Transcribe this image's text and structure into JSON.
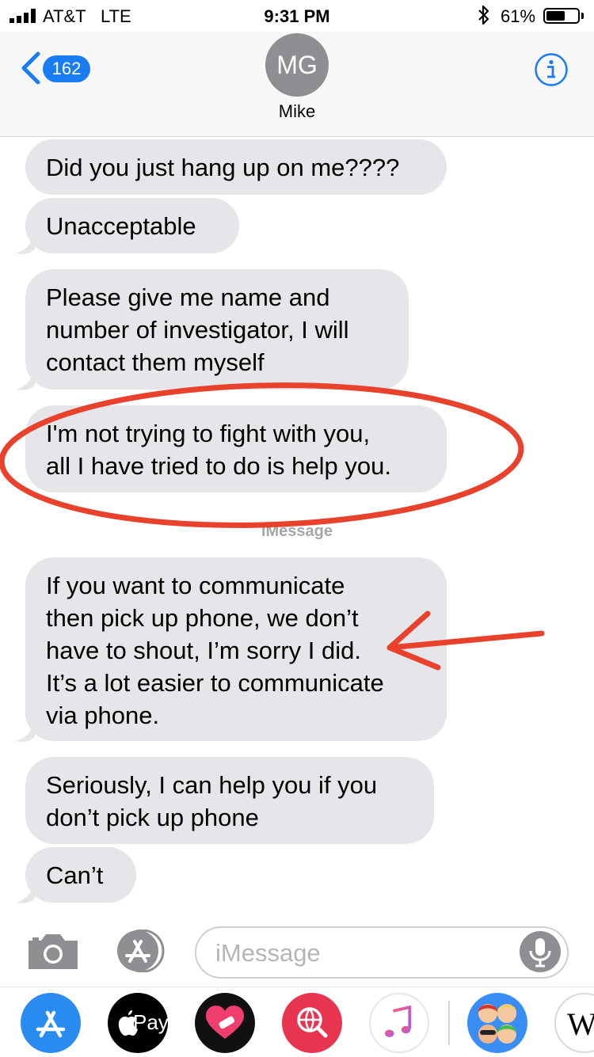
{
  "status_bar": {
    "carrier": "AT&T",
    "network": "LTE",
    "time": "9:31 PM",
    "battery_percent": "61%",
    "battery_level": 0.61
  },
  "header": {
    "back_count": "162",
    "avatar_initials": "MG",
    "contact_name": "Mike"
  },
  "messages": [
    "Did you just hang up on me????",
    "Unacceptable",
    "Please give me name and\nnumber of investigator, I will\ncontact them myself",
    "I'm not trying to fight with you,\nall I have tried to do is help you.",
    "If you want to communicate\nthen pick up phone, we don’t\nhave to shout, I’m sorry I did.\nIt’s a lot easier to communicate\nvia phone.",
    "Seriously, I can help you if you\ndon’t pick up phone",
    "Can’t"
  ],
  "separator_label": "iMessage",
  "input": {
    "placeholder": "iMessage"
  },
  "app_drawer": {
    "apple_pay_label": "Pay",
    "wikipedia_label": "W"
  },
  "colors": {
    "ios_blue": "#1a7cf3",
    "bubble_gray": "#e5e5ea",
    "annotation_red": "#e8412c"
  }
}
